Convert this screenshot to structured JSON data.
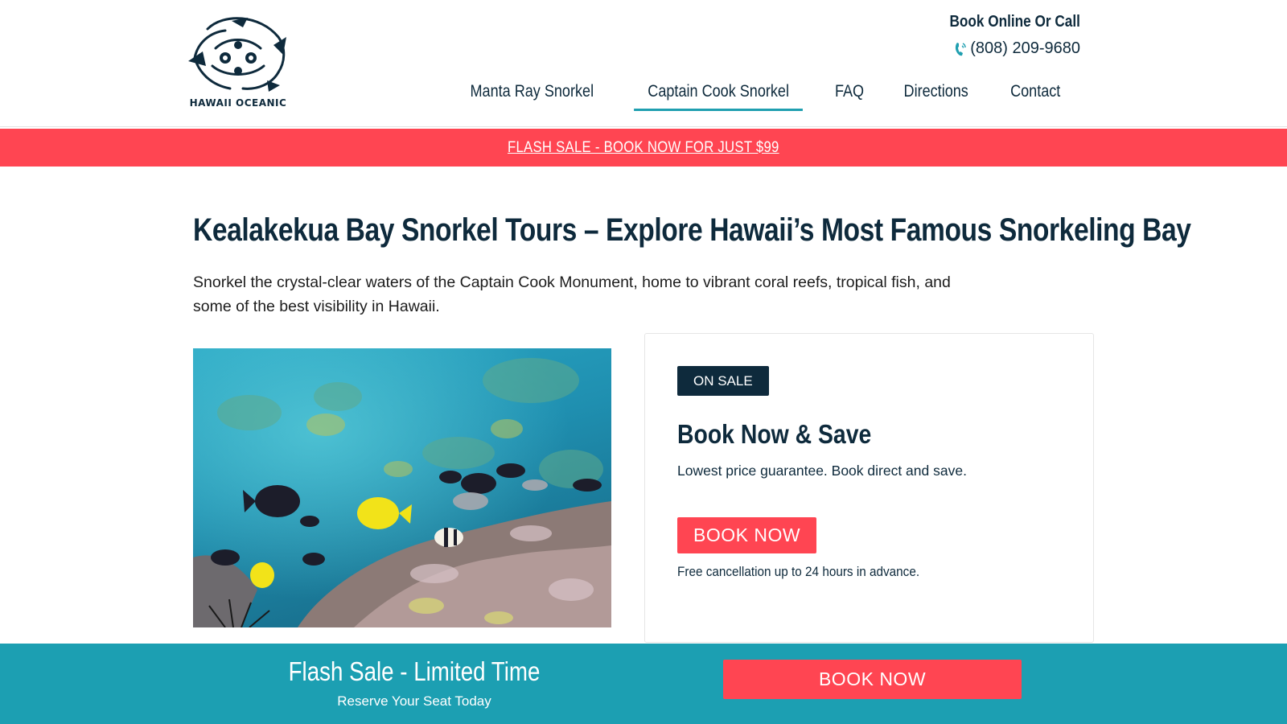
{
  "header": {
    "logo_text": "HAWAII OCEANIC",
    "book_online": "Book Online Or Call",
    "phone": "(808) 209-9680",
    "phone_icon": "phone-icon",
    "nav": [
      {
        "label": "Manta Ray Snorkel",
        "active": false
      },
      {
        "label": "Captain Cook Snorkel",
        "active": true
      },
      {
        "label": "FAQ",
        "active": false
      },
      {
        "label": "Directions",
        "active": false
      },
      {
        "label": "Contact",
        "active": false
      }
    ]
  },
  "flash_banner": {
    "text": "FLASH SALE - BOOK NOW FOR JUST $99",
    "color": "#ff4552"
  },
  "main": {
    "title": "Kealakekua Bay Snorkel Tours – Explore Hawaii’s Most Famous Snorkeling Bay",
    "subtitle": "Snorkel the crystal-clear waters of the Captain Cook Monument, home to vibrant coral reefs, tropical fish, and some of the best visibility in Hawaii."
  },
  "card": {
    "badge": "ON SALE",
    "heading": "Book Now & Save",
    "text": "Lowest price guarantee. Book direct and save.",
    "button": "BOOK NOW",
    "note": "Free cancellation up to 24 hours in advance."
  },
  "sticky_bar": {
    "title": "Flash Sale - Limited Time",
    "subtitle": "Reserve Your Seat Today",
    "button": "BOOK NOW",
    "color": "#1c9fb2"
  },
  "colors": {
    "navy": "#0e2a3c",
    "teal": "#1f9fb0",
    "red": "#ff4552"
  }
}
